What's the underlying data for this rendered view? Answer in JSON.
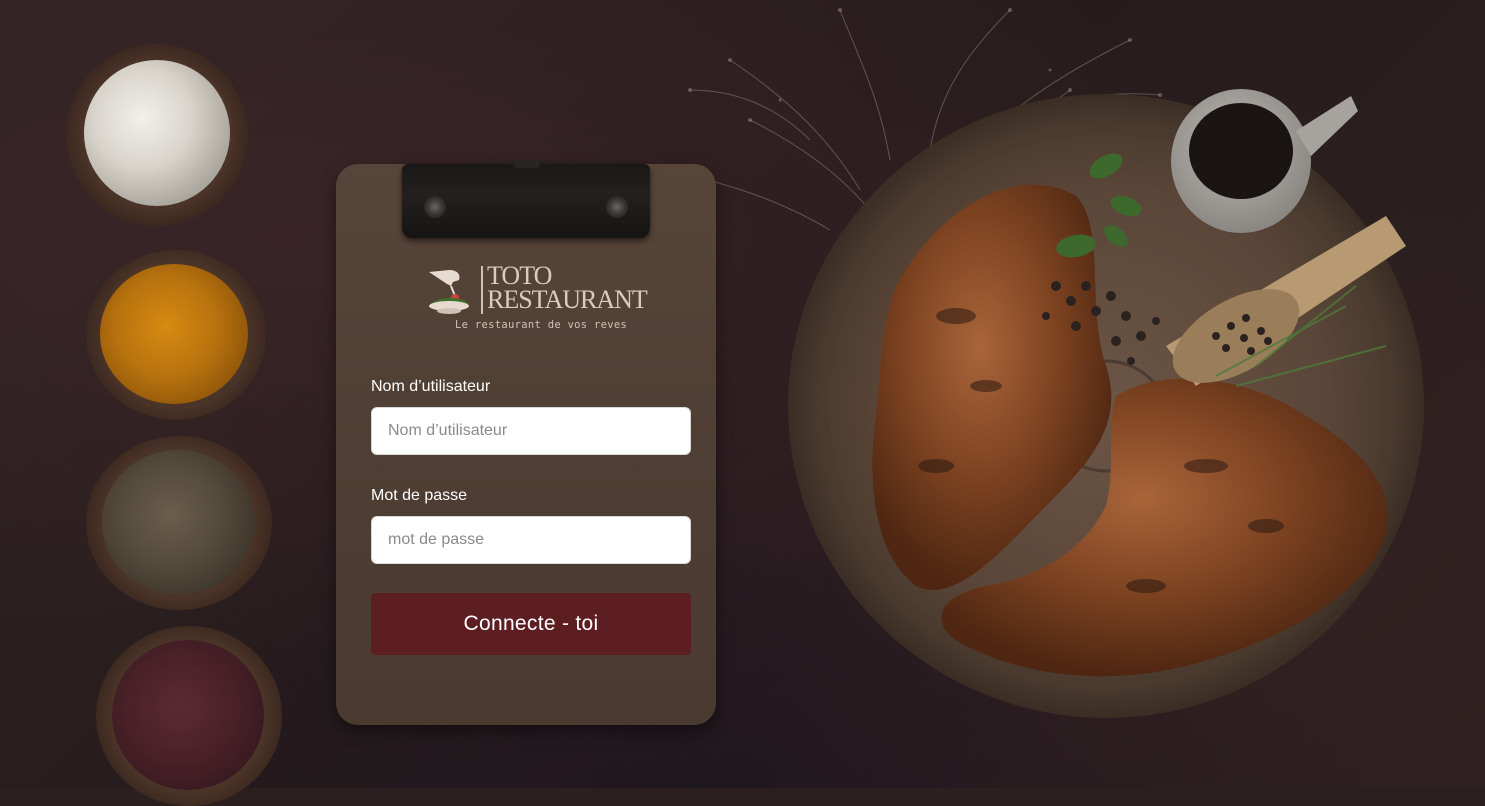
{
  "brand": {
    "title_line1": "TOTO",
    "title_line2": "RESTAURANT",
    "tagline": "Le restaurant de vos reves"
  },
  "form": {
    "username": {
      "label": "Nom d’utilisateur",
      "placeholder": "Nom d’utilisateur",
      "value": ""
    },
    "password": {
      "label": "Mot de passe",
      "placeholder": "mot de passe",
      "value": ""
    },
    "submit_label": "Connecte - toi"
  },
  "colors": {
    "background": "#2b1f1f",
    "clipboard": "#4f3e33",
    "submit_button": "#5d1e21",
    "input_background": "#ffffff",
    "label_text": "#ffffff"
  }
}
